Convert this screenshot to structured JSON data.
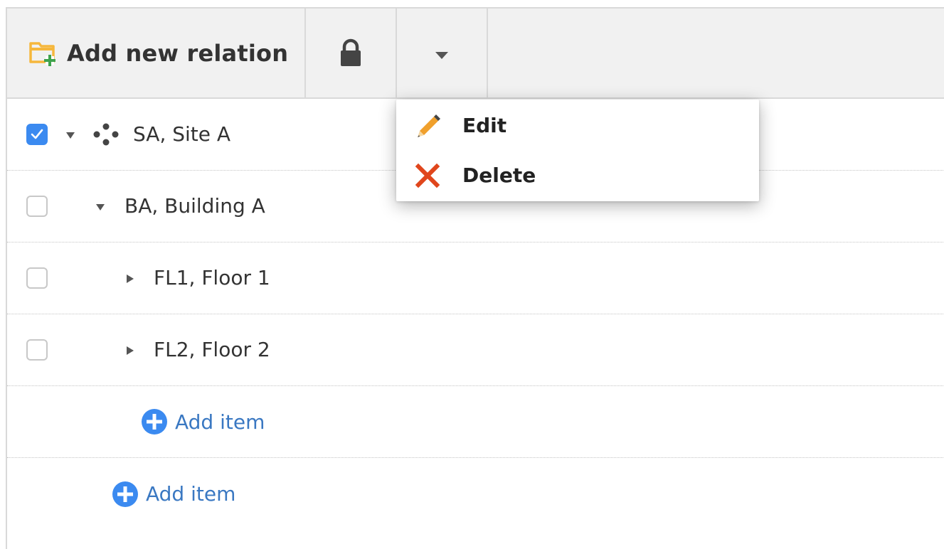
{
  "toolbar": {
    "add_relation_label": "Add new relation",
    "add_relation_icon": "folder-plus-icon",
    "lock_icon": "lock-icon",
    "dropdown_icon": "caret-down-icon"
  },
  "tree": {
    "rows": [
      {
        "label": "SA, Site A",
        "checked": true,
        "expanded": true,
        "icon": "site-nodes-icon"
      },
      {
        "label": "BA, Building A",
        "checked": false,
        "expanded": true
      },
      {
        "label": "FL1, Floor 1",
        "checked": false,
        "expanded": false
      },
      {
        "label": "FL2, Floor 2",
        "checked": false,
        "expanded": false
      }
    ],
    "add_item_inner": "Add item",
    "add_item_outer": "Add item"
  },
  "menu": {
    "items": [
      {
        "label": "Edit",
        "icon": "pencil-icon"
      },
      {
        "label": "Delete",
        "icon": "close-x-icon"
      }
    ]
  },
  "colors": {
    "accent": "#3b8af0",
    "link": "#3a78c2",
    "folder": "#f6b73c",
    "plus_green": "#3fa34d",
    "delete_red": "#e0461c",
    "pencil_orange": "#f0a02c"
  }
}
